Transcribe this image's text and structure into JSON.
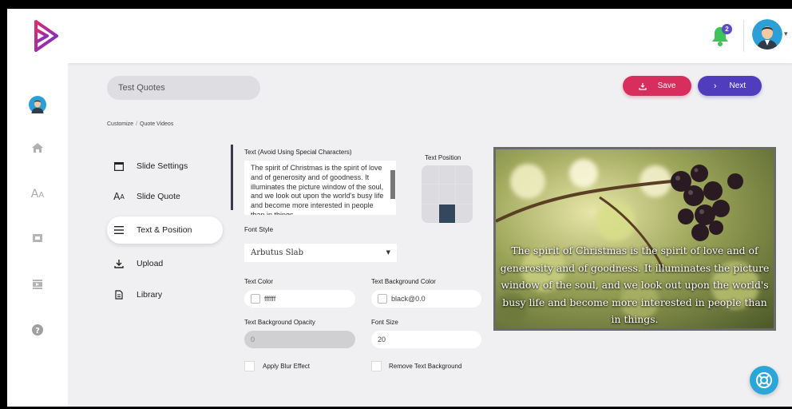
{
  "header": {
    "logo_icon": "play-logo-icon",
    "notification_count": "2",
    "bell_icon": "bell-icon",
    "avatar_icon": "user-avatar-icon"
  },
  "sidebar": {
    "items": [
      {
        "icon": "user-avatar-icon"
      },
      {
        "icon": "home-icon"
      },
      {
        "icon": "font-icon"
      },
      {
        "icon": "video-template-icon"
      },
      {
        "icon": "film-icon"
      },
      {
        "icon": "help-icon"
      }
    ]
  },
  "project": {
    "name": "Test Quotes"
  },
  "actions": {
    "save_label": "Save",
    "next_label": "Next"
  },
  "breadcrumb": {
    "first": "Customize",
    "separator": "/",
    "second": "Quote Videos"
  },
  "menu": {
    "items": [
      {
        "label": "Slide Settings",
        "icon": "slide-icon"
      },
      {
        "label": "Slide Quote",
        "icon": "font-icon"
      },
      {
        "label": "Text & Position",
        "icon": "menu-lines-icon"
      },
      {
        "label": "Upload",
        "icon": "upload-icon"
      },
      {
        "label": "Library",
        "icon": "document-icon"
      }
    ],
    "active_index": 2
  },
  "form": {
    "text_label": "Text (Avoid Using Special Characters)",
    "text_value": "The spirit of Christmas is the spirit of love and of generosity and of goodness. It illuminates the picture window of the soul, and we look out upon the world's busy life and become more interested in people than in things.",
    "position_label": "Text Position",
    "position_selected": "bottom-center",
    "font_style_label": "Font Style",
    "font_style_value": "Arbutus Slab",
    "text_color_label": "Text Color",
    "text_color_value": "ffffff",
    "text_bg_color_label": "Text Background Color",
    "text_bg_color_value": "black@0.0",
    "text_bg_opacity_label": "Text Background Opacity",
    "text_bg_opacity_value": "0",
    "font_size_label": "Font Size",
    "font_size_value": "20",
    "blur_label": "Apply Blur Effect",
    "remove_bg_label": "Remove Text Background"
  },
  "preview": {
    "quote": "The spirit of Christmas is the spirit of love and of generosity and of goodness. It illuminates the picture window of the soul, and we look out upon the world's busy life and become more interested in people than in things."
  },
  "colors": {
    "save": "#d72e5d",
    "next": "#4f3dbd",
    "help_fab": "#2aa7d8",
    "bell": "#3cc35a"
  }
}
